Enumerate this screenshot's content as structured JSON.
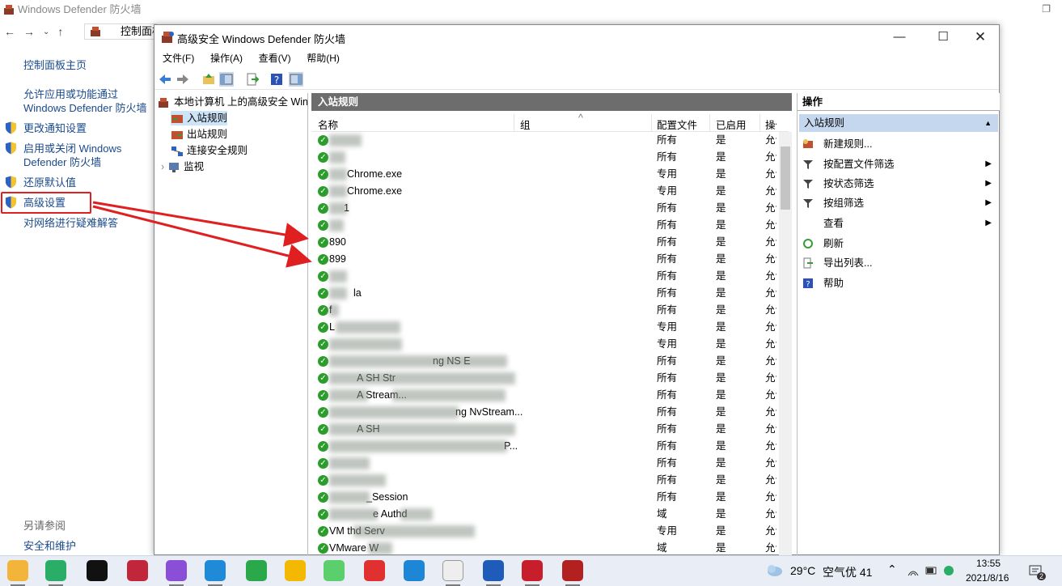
{
  "bg_window": {
    "title": "Windows Defender 防火墙",
    "address": "控制面板",
    "nav_icons": [
      "back-arrow-icon",
      "forward-arrow-icon",
      "dropdown-icon",
      "up-arrow-icon"
    ],
    "links": [
      {
        "label": "控制面板主页",
        "shield": false
      },
      {
        "label": "允许应用或功能通过 Windows Defender 防火墙",
        "shield": false
      },
      {
        "label": "更改通知设置",
        "shield": true
      },
      {
        "label": "启用或关闭 Windows Defender 防火墙",
        "shield": true
      },
      {
        "label": "还原默认值",
        "shield": true
      },
      {
        "label": "高级设置",
        "shield": true
      },
      {
        "label": "对网络进行疑难解答",
        "shield": false
      }
    ],
    "see_also": "另请参阅",
    "security_link": "安全和维护"
  },
  "fg_window": {
    "title": "高级安全 Windows Defender 防火墙",
    "menu": [
      "文件(F)",
      "操作(A)",
      "查看(V)",
      "帮助(H)"
    ],
    "tree": {
      "root": "本地计算机 上的高级安全 Windows Defender 防火墙",
      "items": [
        "入站规则",
        "出站规则",
        "连接安全规则",
        "监视"
      ]
    },
    "center_header": "入站规则",
    "columns": [
      "名称",
      "组",
      "配置文件",
      "已启用",
      "操作"
    ],
    "rows": [
      {
        "name": "",
        "profile": "所有",
        "enabled": "是",
        "action": "允许"
      },
      {
        "name": "",
        "profile": "所有",
        "enabled": "是",
        "action": "允许"
      },
      {
        "name": "Chrome.exe",
        "profile": "专用",
        "enabled": "是",
        "action": "允许"
      },
      {
        "name": "Chrome.exe",
        "profile": "专用",
        "enabled": "是",
        "action": "允许"
      },
      {
        "name": "1",
        "profile": "所有",
        "enabled": "是",
        "action": "允许"
      },
      {
        "name": "",
        "profile": "所有",
        "enabled": "是",
        "action": "允许"
      },
      {
        "name": "890",
        "profile": "所有",
        "enabled": "是",
        "action": "允许"
      },
      {
        "name": "899",
        "profile": "所有",
        "enabled": "是",
        "action": "允许"
      },
      {
        "name": "",
        "profile": "所有",
        "enabled": "是",
        "action": "允许"
      },
      {
        "name": "la",
        "profile": "所有",
        "enabled": "是",
        "action": "允许"
      },
      {
        "name": "f",
        "profile": "所有",
        "enabled": "是",
        "action": "允许"
      },
      {
        "name": "L",
        "profile": "专用",
        "enabled": "是",
        "action": "允许"
      },
      {
        "name": "",
        "profile": "专用",
        "enabled": "是",
        "action": "允许"
      },
      {
        "name": "ng NS E",
        "profile": "所有",
        "enabled": "是",
        "action": "允许"
      },
      {
        "name": "A SH Str",
        "profile": "所有",
        "enabled": "是",
        "action": "允许"
      },
      {
        "name": "A Stream...",
        "profile": "所有",
        "enabled": "是",
        "action": "允许"
      },
      {
        "name": "ng NvStream...",
        "profile": "所有",
        "enabled": "是",
        "action": "允许"
      },
      {
        "name": "A SH",
        "profile": "所有",
        "enabled": "是",
        "action": "允许"
      },
      {
        "name": "P...",
        "profile": "所有",
        "enabled": "是",
        "action": "允许"
      },
      {
        "name": "",
        "profile": "所有",
        "enabled": "是",
        "action": "允许"
      },
      {
        "name": "",
        "profile": "所有",
        "enabled": "是",
        "action": "允许"
      },
      {
        "name": "_Session",
        "profile": "所有",
        "enabled": "是",
        "action": "允许"
      },
      {
        "name": "e Authd",
        "profile": "域",
        "enabled": "是",
        "action": "允许"
      },
      {
        "name": "VM thd Serv",
        "profile": "专用",
        "enabled": "是",
        "action": "允许"
      },
      {
        "name": "VMware W",
        "profile": "域",
        "enabled": "是",
        "action": "允许"
      }
    ],
    "actions_header": "操作",
    "actions_sub": "入站规则",
    "actions": [
      {
        "label": "新建规则...",
        "icon": "new-rule-icon",
        "arrow": false
      },
      {
        "label": "按配置文件筛选",
        "icon": "filter-icon",
        "arrow": true
      },
      {
        "label": "按状态筛选",
        "icon": "filter-icon",
        "arrow": true
      },
      {
        "label": "按组筛选",
        "icon": "filter-icon",
        "arrow": true
      },
      {
        "label": "查看",
        "icon": "",
        "arrow": true
      },
      {
        "label": "刷新",
        "icon": "refresh-icon",
        "arrow": false
      },
      {
        "label": "导出列表...",
        "icon": "export-icon",
        "arrow": false
      },
      {
        "label": "帮助",
        "icon": "help-icon",
        "arrow": false
      }
    ]
  },
  "taskbar": {
    "weather_temp": "29°C",
    "weather_aqi": "空气优 41",
    "time": "13:55",
    "date": "2021/8/16",
    "notif_count": "2",
    "apps": [
      "file-explorer-icon",
      "wechat-icon",
      "qq-icon",
      "jetbrains-icon",
      "visual-studio-icon",
      "vscode-icon",
      "hbuilder-icon",
      "baidu-netdisk-icon",
      "wechat-green-icon",
      "netease-music-icon",
      "edge-icon",
      "typora-icon",
      "remote-desktop-icon",
      "mini-app-icon",
      "filezilla-icon"
    ]
  },
  "colors": {
    "accent_red": "#e02020",
    "header_gray": "#6d6d6d",
    "selection": "#c5d7ee",
    "check_green": "#2a9d2a"
  }
}
